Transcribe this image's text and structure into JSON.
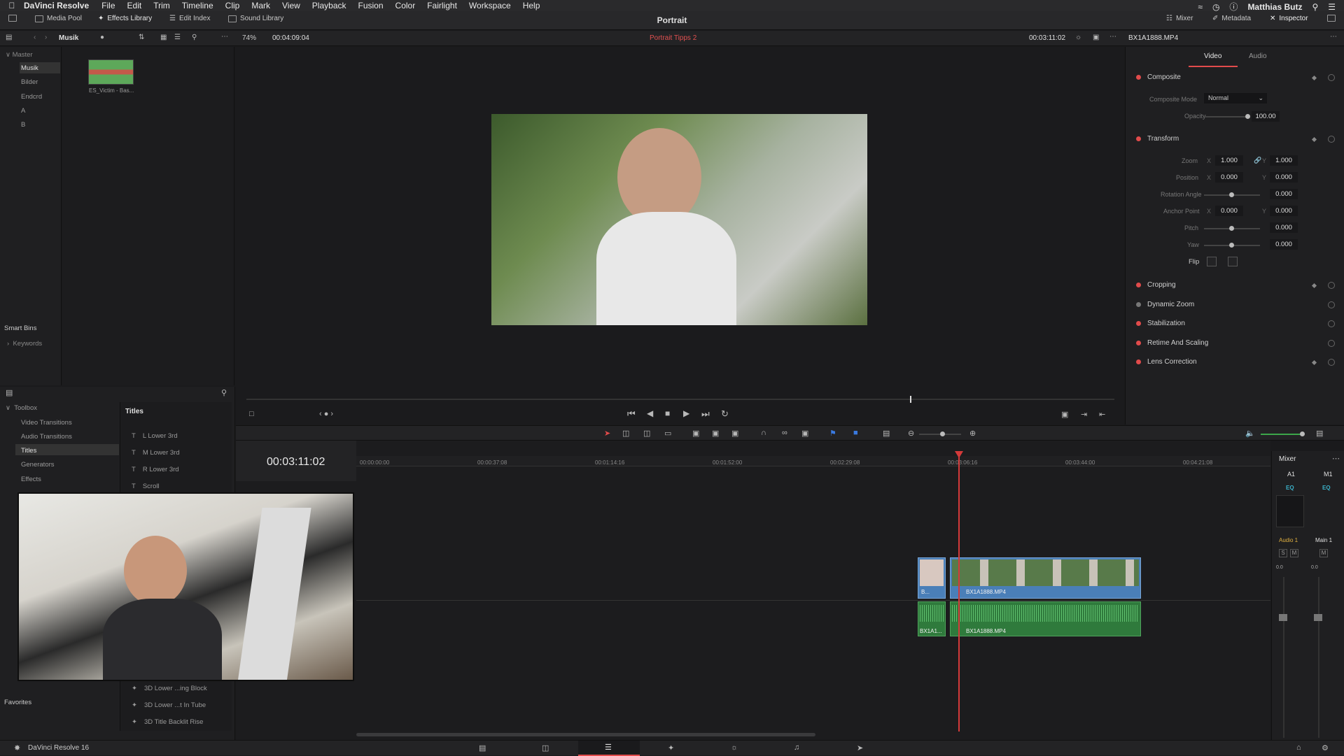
{
  "mac_menu": {
    "app_name": "DaVinci Resolve",
    "items": [
      "File",
      "Edit",
      "Trim",
      "Timeline",
      "Clip",
      "Mark",
      "View",
      "Playback",
      "Fusion",
      "Color",
      "Fairlight",
      "Workspace",
      "Help"
    ],
    "user": "Matthias Butz"
  },
  "toolbar": {
    "media_pool": "Media Pool",
    "effects_library": "Effects Library",
    "edit_index": "Edit Index",
    "sound_library": "Sound Library",
    "project_title": "Portrait",
    "mixer": "Mixer",
    "metadata": "Metadata",
    "inspector": "Inspector"
  },
  "subbar": {
    "bin_name": "Musik",
    "zoom": "74%",
    "source_timecode": "00:04:09:04",
    "timeline_name": "Portrait Tipps 2",
    "record_timecode": "00:03:11:02",
    "clip_name": "BX1A1888.MP4"
  },
  "bins": {
    "master": "Master",
    "items": [
      "Musik",
      "Bilder",
      "Endcrd",
      "A",
      "B"
    ],
    "smart_bins": "Smart Bins",
    "keywords": "Keywords"
  },
  "clip_thumb": {
    "label": "ES_Victim - Bas..."
  },
  "inspector": {
    "tabs": [
      "Video",
      "Audio"
    ],
    "composite": {
      "title": "Composite",
      "mode_label": "Composite Mode",
      "mode_value": "Normal",
      "opacity_label": "Opacity",
      "opacity_value": "100.00"
    },
    "transform": {
      "title": "Transform",
      "zoom_label": "Zoom",
      "zoom_x": "1.000",
      "zoom_y": "1.000",
      "position_label": "Position",
      "position_x": "0.000",
      "position_y": "0.000",
      "rotation_label": "Rotation Angle",
      "rotation_value": "0.000",
      "anchor_label": "Anchor Point",
      "anchor_x": "0.000",
      "anchor_y": "0.000",
      "pitch_label": "Pitch",
      "pitch_value": "0.000",
      "yaw_label": "Yaw",
      "yaw_value": "0.000",
      "flip_label": "Flip",
      "x": "X",
      "y": "Y"
    },
    "sections": [
      "Cropping",
      "Dynamic Zoom",
      "Stabilization",
      "Retime And Scaling",
      "Lens Correction"
    ]
  },
  "toolbox": {
    "title": "Toolbox",
    "items": [
      "Video Transitions",
      "Audio Transitions",
      "Titles",
      "Generators",
      "Effects"
    ],
    "favorites": "Favorites"
  },
  "titles_panel": {
    "header": "Titles",
    "items": [
      "L Lower 3rd",
      "M Lower 3rd",
      "R Lower 3rd",
      "Scroll"
    ],
    "fusion_items": [
      "3D Lower ...ing Block",
      "3D Lower ...t In Tube",
      "3D Title Backlit Rise"
    ]
  },
  "timeline": {
    "timecode": "00:03:11:02",
    "ruler": [
      "00:00:00:00",
      "00:00:37:08",
      "00:01:14:16",
      "00:01:52:00",
      "00:02:29:08",
      "00:03:06:16",
      "00:03:44:00",
      "00:04:21:08"
    ],
    "video_clip_short": "B...",
    "video_clip": "BX1A1888.MP4",
    "audio_clip_short": "BX1A1...",
    "audio_clip": "BX1A1888.MP4"
  },
  "mixer": {
    "title": "Mixer",
    "channels": [
      "A1",
      "M1"
    ],
    "eq": "EQ",
    "strips": [
      "Audio 1",
      "Main 1"
    ],
    "solo": "S",
    "mute": "M",
    "levels": [
      "0.0",
      "0.0"
    ]
  },
  "bottom": {
    "app_version": "DaVinci Resolve 16"
  },
  "colors": {
    "accent_red": "#e14b4b",
    "playhead": "#d43a3a",
    "video_clip": "#4a7fb8",
    "audio_clip": "#2f7a3c",
    "timeline_name": "#e05050"
  }
}
